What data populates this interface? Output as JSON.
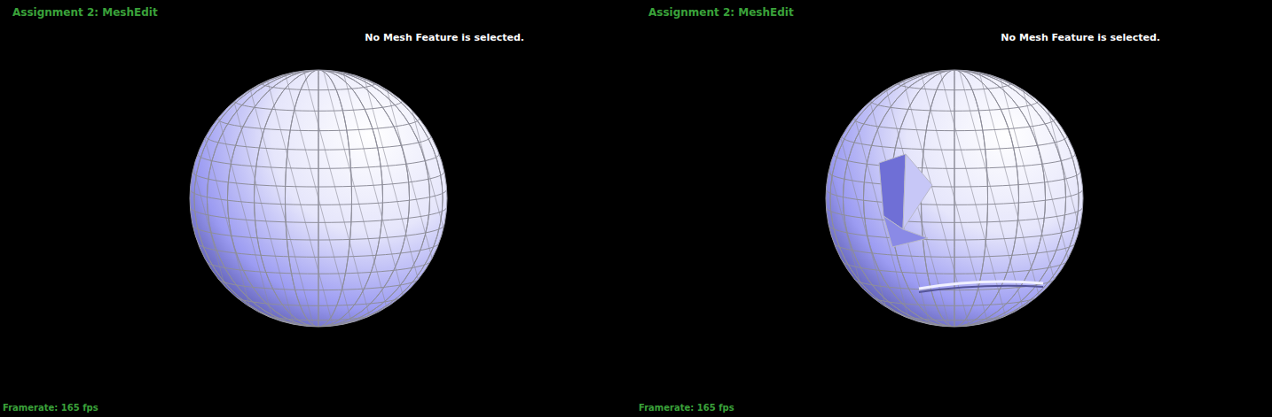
{
  "panels": [
    {
      "title": "Assignment 2: MeshEdit",
      "status": "No Mesh Feature is selected.",
      "framerate": "Framerate: 165 fps",
      "mesh": {
        "distorted": false
      }
    },
    {
      "title": "Assignment 2: MeshEdit",
      "status": "No Mesh Feature is selected.",
      "framerate": "Framerate: 165 fps",
      "mesh": {
        "distorted": true
      }
    }
  ]
}
